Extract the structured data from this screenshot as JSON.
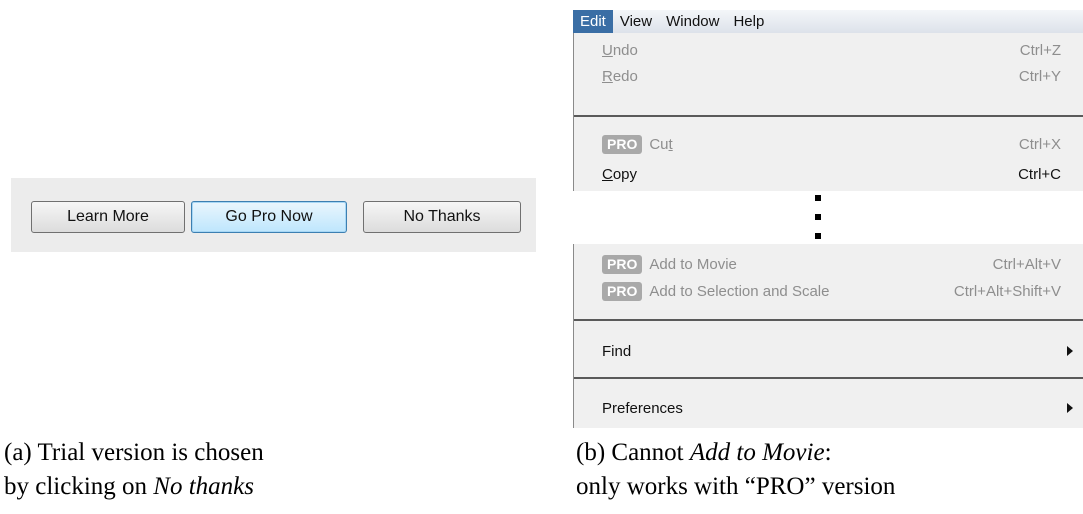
{
  "dialog": {
    "buttons": {
      "learn_more": "Learn More",
      "go_pro": "Go Pro Now",
      "no_thanks": "No Thanks"
    }
  },
  "menubar": {
    "items": [
      "Edit",
      "View",
      "Window",
      "Help"
    ],
    "active": "Edit"
  },
  "menu": {
    "pro_badge": "PRO",
    "undo": {
      "mnemonic": "U",
      "rest": "ndo",
      "shortcut": "Ctrl+Z",
      "enabled": false
    },
    "redo": {
      "mnemonic": "R",
      "rest": "edo",
      "shortcut": "Ctrl+Y",
      "enabled": false
    },
    "cut": {
      "prefix": "Cu",
      "mnemonic": "t",
      "shortcut": "Ctrl+X",
      "enabled": false,
      "pro": true
    },
    "copy": {
      "mnemonic": "C",
      "rest": "opy",
      "shortcut": "Ctrl+C",
      "enabled": true
    },
    "add_to_movie": {
      "label": "Add to Movie",
      "shortcut": "Ctrl+Alt+V",
      "enabled": false,
      "pro": true
    },
    "add_to_selection": {
      "label": "Add to Selection and Scale",
      "shortcut": "Ctrl+Alt+Shift+V",
      "enabled": false,
      "pro": true
    },
    "find": {
      "label": "Find",
      "submenu": true
    },
    "preferences": {
      "label": "Preferences",
      "submenu": true
    }
  },
  "captions": {
    "a": {
      "line1": "(a) Trial version is chosen",
      "line2_plain": "by clicking on ",
      "line2_italic": "No thanks"
    },
    "b": {
      "line1_plain": "(b) Cannot ",
      "line1_italic": "Add to Movie",
      "line1_suffix": ":",
      "line2": "only works with “PRO” version"
    }
  },
  "colors": {
    "menu_highlight": "#3a6ea5",
    "disabled_text": "#8e8e8e",
    "pro_badge_bg": "#a9a9a9",
    "go_pro_border": "#3c7fb1"
  }
}
